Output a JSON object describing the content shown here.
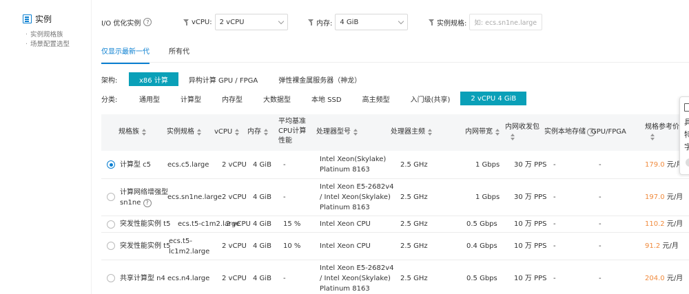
{
  "sidebar": {
    "title": "实例",
    "items": [
      {
        "label": "实例规格族"
      },
      {
        "label": "场景配置选型"
      }
    ]
  },
  "filters": {
    "io_label": "I/O 优化实例",
    "vcpu_label": "vCPU:",
    "vcpu_value": "2 vCPU",
    "memory_label": "内存:",
    "memory_value": "4 GiB",
    "spec_label": "实例规格:",
    "spec_placeholder": "如: ecs.sn1ne.large"
  },
  "generation_tabs": [
    {
      "label": "仅显示最新一代",
      "active": true
    },
    {
      "label": "所有代",
      "active": false
    }
  ],
  "architecture": {
    "label": "架构:",
    "options": [
      {
        "label": "x86 计算",
        "active": true
      },
      {
        "label": "异构计算 GPU / FPGA",
        "active": false
      },
      {
        "label": "弹性裸金属服务器（神龙）",
        "active": false
      }
    ]
  },
  "category": {
    "label": "分类:",
    "options": [
      {
        "label": "通用型",
        "active": false
      },
      {
        "label": "计算型",
        "active": false
      },
      {
        "label": "内存型",
        "active": false
      },
      {
        "label": "大数据型",
        "active": false
      },
      {
        "label": "本地 SSD",
        "active": false
      },
      {
        "label": "高主频型",
        "active": false
      },
      {
        "label": "入门级(共享)",
        "active": false
      },
      {
        "label": "2 vCPU 4 GiB",
        "active": true
      }
    ]
  },
  "table": {
    "headers": {
      "family": "规格族",
      "spec": "实例规格",
      "vcpu": "vCPU",
      "memory": "内存",
      "baseline": "平均基准CPU计算性能",
      "processor": "处理器型号",
      "frequency": "处理器主频",
      "bandwidth": "内网带宽",
      "pps": "内网收发包",
      "local_storage": "实例本地存储",
      "gpu": "GPU/FPGA",
      "price": "规格参考价"
    },
    "rows": [
      {
        "selected": true,
        "family": "计算型 c5",
        "spec": "ecs.c5.large",
        "vcpu": "2 vCPU",
        "memory": "4 GiB",
        "baseline": "-",
        "processor": "Intel Xeon(Skylake) Platinum 8163",
        "frequency": "2.5 GHz",
        "bandwidth": "1 Gbps",
        "pps": "30 万 PPS",
        "local_storage": "-",
        "gpu": "-",
        "price": "179.0",
        "price_unit": "元/月"
      },
      {
        "selected": false,
        "family": "计算网络增强型 sn1ne",
        "spec": "ecs.sn1ne.large",
        "vcpu": "2 vCPU",
        "memory": "4 GiB",
        "baseline": "-",
        "processor": "Intel Xeon E5-2682v4 / Intel Xeon(Skylake) Platinum 8163",
        "frequency": "2.5 GHz",
        "bandwidth": "1 Gbps",
        "pps": "30 万 PPS",
        "local_storage": "-",
        "gpu": "-",
        "price": "197.0",
        "price_unit": "元/月"
      },
      {
        "selected": false,
        "family": "突发性能实例 t5",
        "spec": "ecs.t5-c1m2.large",
        "vcpu": "2 vCPU",
        "memory": "4 GiB",
        "baseline": "15 %",
        "processor": "Intel Xeon CPU",
        "frequency": "2.5 GHz",
        "bandwidth": "0.5 Gbps",
        "pps": "10 万 PPS",
        "local_storage": "-",
        "gpu": "-",
        "price": "110.2",
        "price_unit": "元/月"
      },
      {
        "selected": false,
        "family": "突发性能实例 t5",
        "spec": "ecs.t5-lc1m2.large",
        "vcpu": "2 vCPU",
        "memory": "4 GiB",
        "baseline": "10 %",
        "processor": "Intel Xeon CPU",
        "frequency": "2.5 GHz",
        "bandwidth": "0.4 Gbps",
        "pps": "10 万 PPS",
        "local_storage": "-",
        "gpu": "-",
        "price": "91.2",
        "price_unit": "元/月"
      },
      {
        "selected": false,
        "family": "共享计算型 n4",
        "spec": "ecs.n4.large",
        "vcpu": "2 vCPU",
        "memory": "4 GiB",
        "baseline": "-",
        "processor": "Intel Xeon E5-2682v4 / Intel Xeon(Skylake) Platinum 8163",
        "frequency": "2.5 GHz",
        "bandwidth": "0.5 Gbps",
        "pps": "10 万 PPS",
        "local_storage": "-",
        "gpu": "-",
        "price": "204.0",
        "price_unit": "元/月"
      }
    ]
  },
  "float_panel": {
    "line1": "具",
    "line2": "特",
    "line3": "字"
  },
  "colors": {
    "accent": "#0a7fd1",
    "active_chip": "#0aa0b8",
    "price": "#f08a3c"
  }
}
